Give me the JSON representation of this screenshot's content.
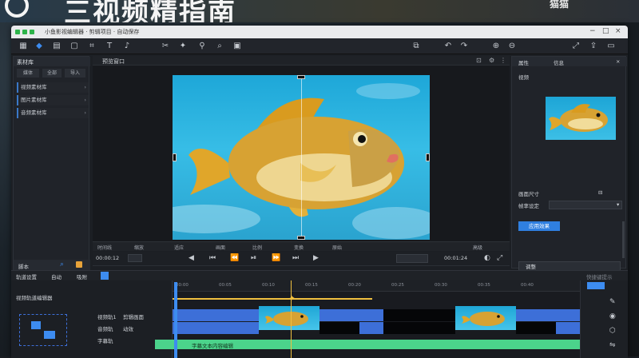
{
  "banner": {
    "title": "三视频精指南",
    "tag": "猫猫"
  },
  "window": {
    "title": "小鱼影视编辑器 · 剪辑项目 · 自动保存"
  },
  "colors": {
    "accent": "#3d8cf0",
    "playhead": "#f0c040",
    "track_blue": "#3d6fd8",
    "track_green": "#4bd38b",
    "water": "#1ea7d8"
  },
  "toolbar": {
    "tools": [
      "grid-icon",
      "diamond-icon",
      "layers-icon",
      "frame-icon",
      "crop-icon",
      "text-icon",
      "audio-icon",
      "cut-icon",
      "magic-icon",
      "link-icon",
      "search-icon",
      "image-icon"
    ],
    "right_tools": [
      "copy-icon",
      "undo-icon",
      "redo-icon",
      "zoom-in-icon",
      "zoom-out-icon",
      "fullscreen-icon",
      "share-icon",
      "export-icon"
    ]
  },
  "left_panel": {
    "tab": "素材库",
    "segments": [
      "媒体",
      "全部",
      "导入"
    ],
    "items": [
      "视频素材库",
      "图片素材库",
      "音频素材库"
    ],
    "footer": "脚本"
  },
  "preview": {
    "title": "预览窗口",
    "strip": [
      "时间线",
      "缩放",
      "适应",
      "画面",
      "比例",
      "变换",
      "原始",
      "高级"
    ],
    "controls": [
      "◀",
      "⏮",
      "⏪",
      "⏯",
      "⏩",
      "⏭",
      "▶"
    ],
    "time_left": "00:00:12",
    "time_right": "00:01:24"
  },
  "right_panel": {
    "tabs": [
      "属性",
      "信息"
    ],
    "label": "视频",
    "fields": [
      "画面尺寸",
      "帧率设定"
    ],
    "button": "应用效果",
    "bar": "调整"
  },
  "timeline": {
    "header": [
      "轨道设置",
      "自动",
      "吸附"
    ],
    "label": "视频轨道编辑器",
    "ticks": [
      "00:00",
      "00:05",
      "00:10",
      "00:15",
      "00:20",
      "00:25",
      "00:30",
      "00:35",
      "00:40"
    ],
    "tracks": [
      "视频轨1",
      "音频轨",
      "字幕轨"
    ],
    "track_tags": [
      "剪辑画面",
      "动效"
    ],
    "subtitle": "字幕文本内容编辑"
  },
  "statusbar": {
    "right": "快捷键提示"
  }
}
